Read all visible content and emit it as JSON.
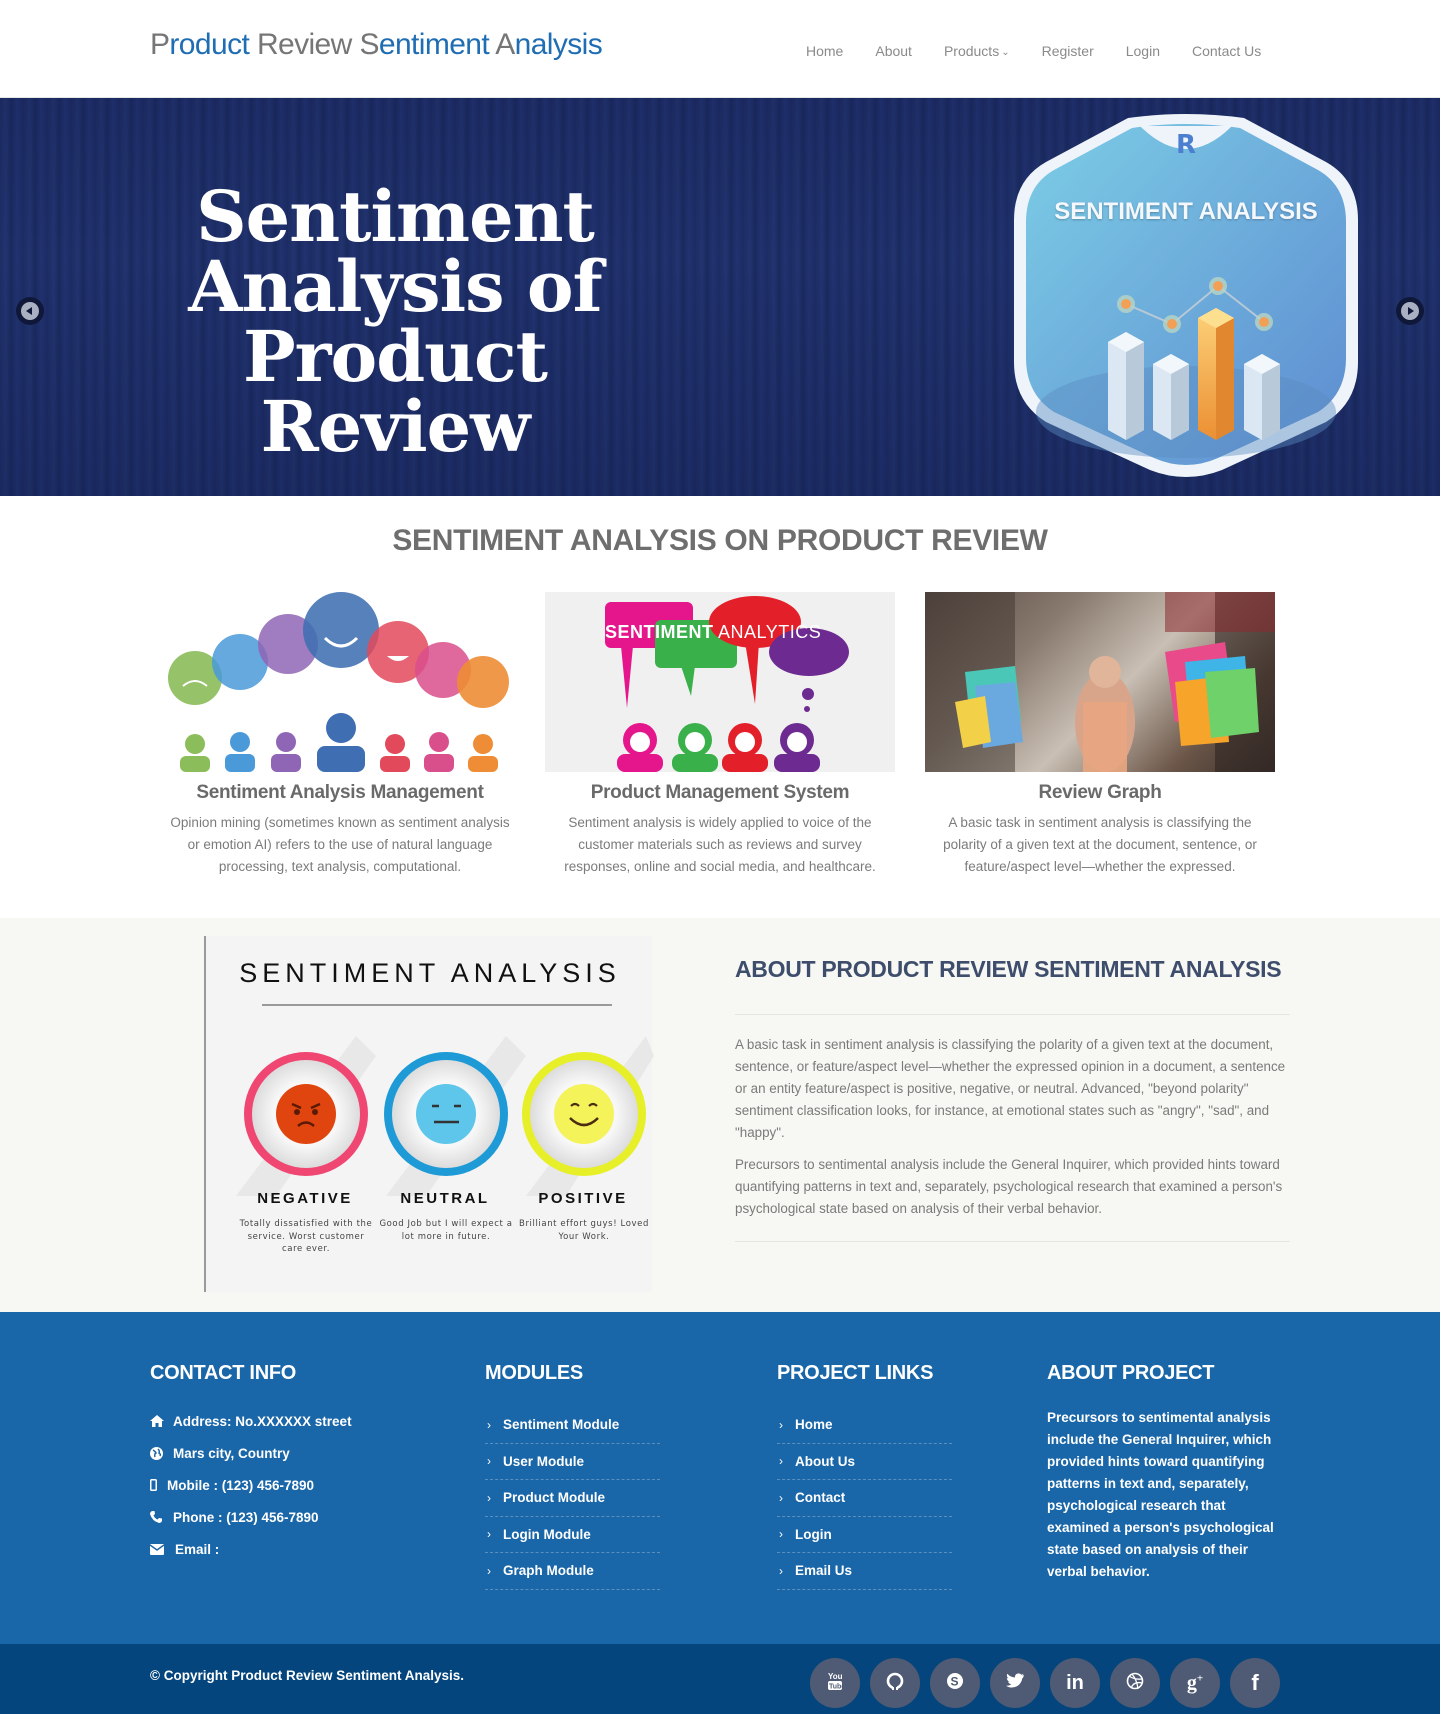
{
  "header": {
    "logo_parts": [
      {
        "text": "P",
        "tone": "gray"
      },
      {
        "text": "roduct ",
        "tone": "blue"
      },
      {
        "text": "Review ",
        "tone": "gray"
      },
      {
        "text": "S",
        "tone": "gray"
      },
      {
        "text": "entiment ",
        "tone": "blue"
      },
      {
        "text": "A",
        "tone": "gray"
      },
      {
        "text": "nalysis",
        "tone": "blue"
      }
    ],
    "nav": [
      {
        "label": "Home",
        "has_dropdown": false
      },
      {
        "label": "About",
        "has_dropdown": false
      },
      {
        "label": "Products",
        "has_dropdown": true
      },
      {
        "label": "Register",
        "has_dropdown": false
      },
      {
        "label": "Login",
        "has_dropdown": false
      },
      {
        "label": "Contact Us",
        "has_dropdown": false
      }
    ],
    "dropdown_icon": "chevron-down-icon"
  },
  "hero": {
    "title_lines": [
      "Sentiment",
      "Analysis of",
      "Product Review"
    ],
    "badge_title": "SENTIMENT ANALYSIS",
    "badge_logo": "R",
    "prev_icon": "chevron-left-icon",
    "next_icon": "chevron-right-icon"
  },
  "features": {
    "title": "SENTIMENT ANALYSIS ON PRODUCT REVIEW",
    "cards": [
      {
        "title": "Sentiment Analysis Management",
        "description": "Opinion mining (sometimes known as sentiment analysis or emotion AI) refers to the use of natural language processing, text analysis, computational.",
        "image": "speech-bubbles-emotions-illustration"
      },
      {
        "title": "Product Management System",
        "description": "Sentiment analysis is widely applied to voice of the customer materials such as reviews and survey responses, online and social media, and healthcare.",
        "image": "sentiment-analytics-illustration",
        "image_text_bold": "SENTIMENT",
        "image_text_light": " ANALYTICS"
      },
      {
        "title": "Review Graph",
        "description": "A basic task in sentiment analysis is classifying the polarity of a given text at the document, sentence, or feature/aspect level—whether the expressed.",
        "image": "shopping-woman-photo"
      }
    ]
  },
  "about": {
    "infographic": {
      "title": "SENTIMENT ANALYSIS",
      "items": [
        {
          "label": "NEGATIVE",
          "text": "Totally dissatisfied with the service. Worst customer care ever.",
          "ring": "#f0426f",
          "face": "#e0450f"
        },
        {
          "label": "NEUTRAL",
          "text": "Good Job but I will expect a lot more in future.",
          "ring": "#1e9ad6",
          "face": "#5dc6ea"
        },
        {
          "label": "POSITIVE",
          "text": "Brilliant effort guys! Loved Your Work.",
          "ring": "#e6ef28",
          "face": "#f5f35a"
        }
      ]
    },
    "heading": "ABOUT PRODUCT REVIEW SENTIMENT ANALYSIS",
    "paragraphs": [
      "A basic task in sentiment analysis is classifying the polarity of a given text at the document, sentence, or feature/aspect level—whether the expressed opinion in a document, a sentence or an entity feature/aspect is positive, negative, or neutral. Advanced, \"beyond polarity\" sentiment classification looks, for instance, at emotional states such as \"angry\", \"sad\", and \"happy\".",
      "Precursors to sentimental analysis include the General Inquirer, which provided hints toward quantifying patterns in text and, separately, psychological research that examined a person's psychological state based on analysis of their verbal behavior."
    ]
  },
  "footer": {
    "contact": {
      "heading": "CONTACT INFO",
      "rows": [
        {
          "icon": "home-icon",
          "text": "Address: No.XXXXXX street"
        },
        {
          "icon": "globe-icon",
          "text": "Mars city, Country"
        },
        {
          "icon": "mobile-icon",
          "text": "Mobile : (123) 456-7890"
        },
        {
          "icon": "phone-icon",
          "text": "Phone : (123) 456-7890"
        },
        {
          "icon": "envelope-icon",
          "text": "Email :"
        }
      ]
    },
    "modules": {
      "heading": "MODULES",
      "links": [
        "Sentiment Module",
        "User Module",
        "Product Module",
        "Login Module",
        "Graph Module"
      ]
    },
    "project_links": {
      "heading": "PROJECT LINKS",
      "links": [
        "Home",
        "About Us",
        "Contact",
        "Login",
        "Email Us"
      ]
    },
    "about_project": {
      "heading": "ABOUT PROJECT",
      "text": "Precursors to sentimental analysis include the General Inquirer, which provided hints toward quantifying patterns in text and, separately, psychological research that examined a person's psychological state based on analysis of their verbal behavior."
    },
    "copyright": "© Copyright Product Review Sentiment Analysis.",
    "socials": [
      {
        "name": "youtube",
        "icon": "youtube-icon"
      },
      {
        "name": "github",
        "icon": "github-icon"
      },
      {
        "name": "skype",
        "icon": "skype-icon"
      },
      {
        "name": "twitter",
        "icon": "twitter-icon"
      },
      {
        "name": "linkedin",
        "icon": "linkedin-icon"
      },
      {
        "name": "dribbble",
        "icon": "dribbble-icon"
      },
      {
        "name": "google-plus",
        "icon": "google-plus-icon"
      },
      {
        "name": "facebook",
        "icon": "facebook-icon"
      }
    ]
  },
  "colors": {
    "brand_blue": "#1f6db3",
    "logo_gray": "#767676",
    "hero_bg": "#1f2f6a",
    "footer_bg": "#1966a8",
    "bottom_bar_bg": "#03457c",
    "about_bg": "#f7f7f3",
    "social_bg": "#4f5b74"
  }
}
